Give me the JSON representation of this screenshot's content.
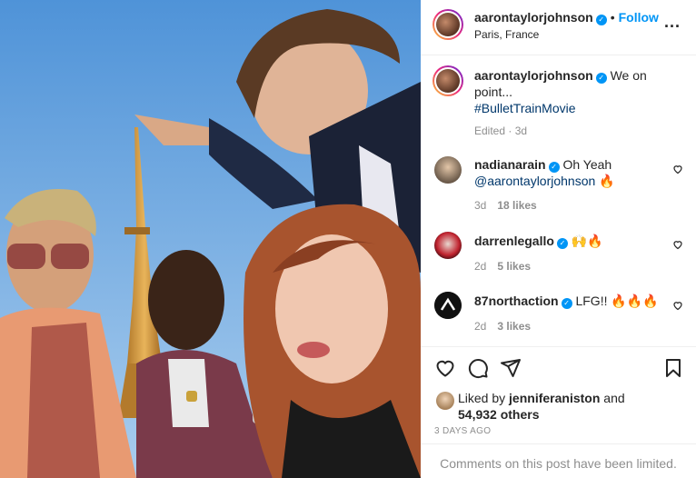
{
  "header": {
    "username": "aarontaylorjohnson",
    "separator": "•",
    "follow_label": "Follow",
    "location": "Paris, France",
    "more_label": "..."
  },
  "caption": {
    "username": "aarontaylorjohnson",
    "text": "We on point...",
    "hashtag": "#BulletTrainMovie",
    "edited": "Edited",
    "time": "3d"
  },
  "comments": [
    {
      "username": "nadianarain",
      "text": "Oh Yeah",
      "mention": "@aarontaylorjohnson",
      "emoji": "🔥",
      "time": "3d",
      "likes": "18 likes"
    },
    {
      "username": "darrenlegallo",
      "text": "",
      "mention": "",
      "emoji": "🙌🔥",
      "time": "2d",
      "likes": "5 likes"
    },
    {
      "username": "87northaction",
      "text": "LFG!!",
      "mention": "",
      "emoji": "🔥🔥🔥",
      "time": "2d",
      "likes": "3 likes"
    }
  ],
  "likes": {
    "prefix": "Liked by",
    "user": "jenniferaniston",
    "conj": "and",
    "count": "54,932 others"
  },
  "post_age": "3 DAYS AGO",
  "comments_limited": "Comments on this post have been limited.",
  "colors": {
    "accent": "#0095f6",
    "link": "#00376b",
    "muted": "#8e8e8e"
  }
}
